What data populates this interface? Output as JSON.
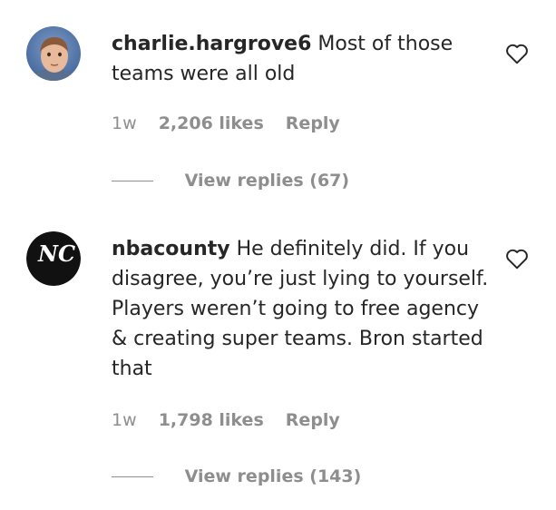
{
  "comments": [
    {
      "username": "charlie.hargrove6",
      "text": "Most of those teams were all old",
      "time": "1w",
      "likes": "2,206 likes",
      "reply_label": "Reply",
      "view_replies": "View replies (67)"
    },
    {
      "username": "nbacounty",
      "text": "He definitely did. If you disagree, you’re just lying to yourself. Players weren’t going to free agency & creating super teams. Bron started that",
      "time": "1w",
      "likes": "1,798 likes",
      "reply_label": "Reply",
      "view_replies": "View replies (143)",
      "avatar_letters": "NC"
    }
  ],
  "icons": {
    "like": "heart-outline-icon"
  },
  "colors": {
    "text": "#262626",
    "secondary": "#8e8e8e"
  }
}
